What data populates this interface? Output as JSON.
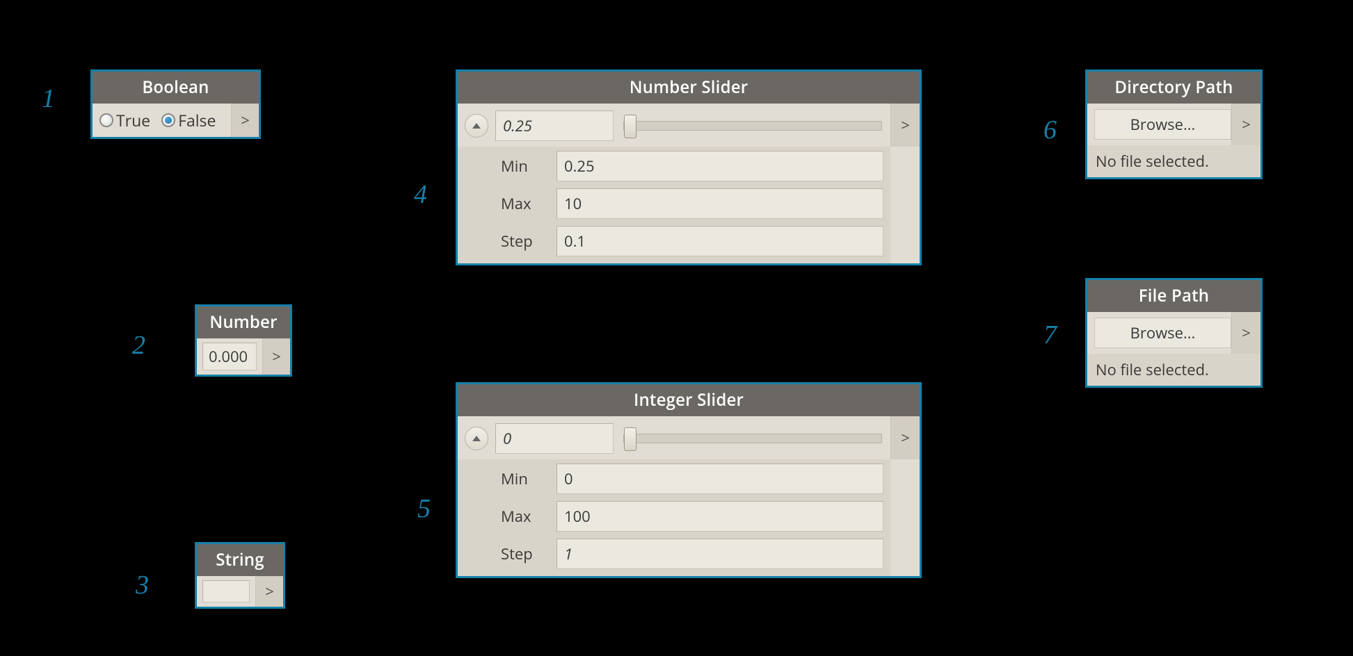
{
  "annotations": {
    "n1": "1",
    "n2": "2",
    "n3": "3",
    "n4": "4",
    "n5": "5",
    "n6": "6",
    "n7": "7"
  },
  "boolean_node": {
    "title": "Boolean",
    "true_label": "True",
    "false_label": "False",
    "selected": "False"
  },
  "number_node": {
    "title": "Number",
    "value": "0.000"
  },
  "string_node": {
    "title": "String",
    "value": ""
  },
  "number_slider": {
    "title": "Number Slider",
    "value": "0.25",
    "min_label": "Min",
    "min": "0.25",
    "max_label": "Max",
    "max": "10",
    "step_label": "Step",
    "step": "0.1"
  },
  "integer_slider": {
    "title": "Integer Slider",
    "value": "0",
    "min_label": "Min",
    "min": "0",
    "max_label": "Max",
    "max": "100",
    "step_label": "Step",
    "step": "1"
  },
  "directory_path": {
    "title": "Directory Path",
    "browse_label": "Browse...",
    "status": "No file selected."
  },
  "file_path": {
    "title": "File Path",
    "browse_label": "Browse...",
    "status": "No file selected."
  },
  "port_glyph": ">"
}
